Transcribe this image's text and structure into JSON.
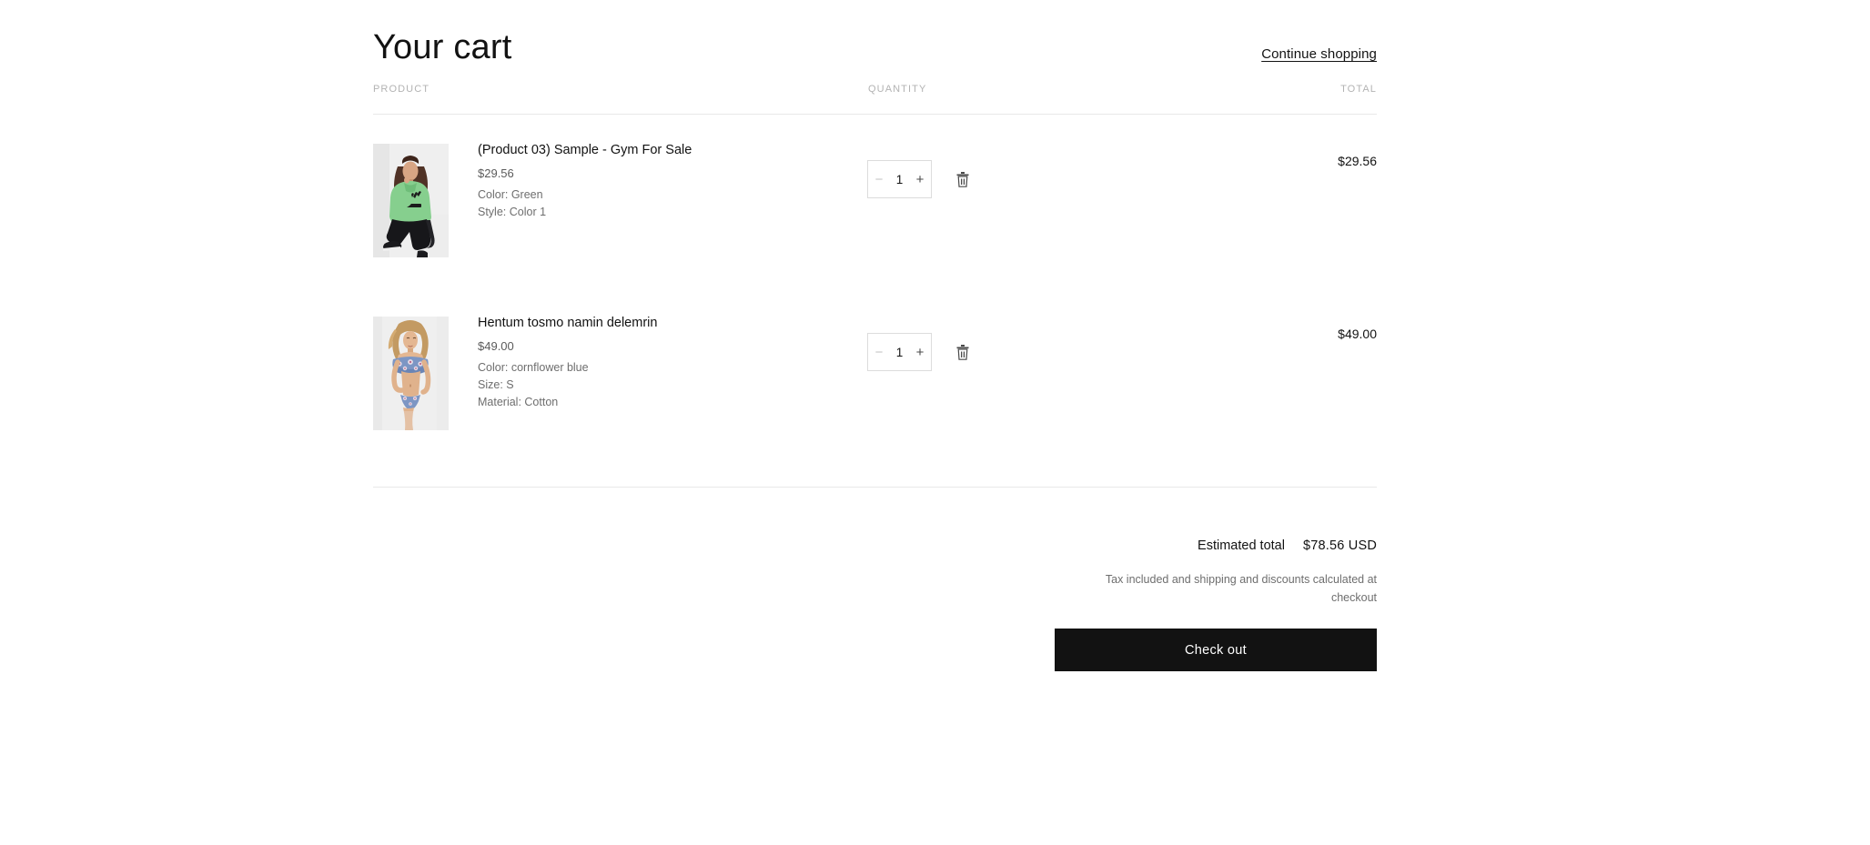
{
  "header": {
    "title": "Your cart",
    "continue_shopping": "Continue shopping"
  },
  "columns": {
    "product": "PRODUCT",
    "quantity": "QUANTITY",
    "total": "TOTAL"
  },
  "items": [
    {
      "name": "(Product 03) Sample - Gym For Sale",
      "price": "$29.56",
      "options": [
        "Color: Green",
        "Style: Color 1"
      ],
      "quantity": "1",
      "line_total": "$29.56",
      "decrease_label": "−",
      "increase_label": "+",
      "remove_icon": "trash-icon",
      "image_alt": "model wearing green hoodie and black pants"
    },
    {
      "name": "Hentum tosmo namin delemrin",
      "price": "$49.00",
      "options": [
        "Color: cornflower blue",
        "Size: S",
        "Material: Cotton"
      ],
      "quantity": "1",
      "line_total": "$49.00",
      "decrease_label": "−",
      "increase_label": "+",
      "remove_icon": "trash-icon",
      "image_alt": "model wearing blue floral bikini"
    }
  ],
  "footer": {
    "estimated_total_label": "Estimated total",
    "estimated_total_value": "$78.56 USD",
    "tax_note": "Tax included and shipping and discounts calculated at checkout",
    "checkout_label": "Check out"
  },
  "colors": {
    "text": "#121212",
    "muted": "#6e6e6e",
    "faint": "#b3b3b3",
    "rule": "#e8e8e8",
    "button": "#121212"
  }
}
